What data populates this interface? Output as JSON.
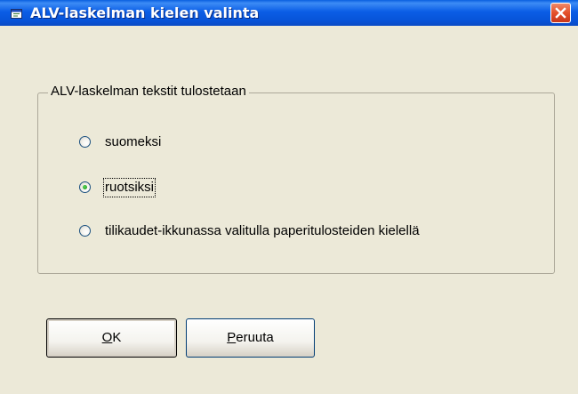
{
  "window": {
    "title": "ALV-laskelman kielen valinta",
    "icon": "app-window-icon"
  },
  "title_controls": {
    "close_icon": "close-icon"
  },
  "group": {
    "legend": "ALV-laskelman tekstit tulostetaan",
    "options": [
      {
        "label": "suomeksi",
        "selected": false
      },
      {
        "label": "ruotsiksi",
        "selected": true,
        "focused": true
      },
      {
        "label": "tilikaudet-ikkunassa valitulla paperitulosteiden kielellä",
        "selected": false
      }
    ]
  },
  "buttons": {
    "ok": {
      "mnemonic": "O",
      "rest": "K"
    },
    "cancel": {
      "mnemonic": "P",
      "rest": "eruuta"
    }
  },
  "colors": {
    "titlebar": "#0753d8",
    "close": "#e4502a",
    "dialog_bg": "#ece9d8",
    "radio_dot": "#21a121"
  }
}
